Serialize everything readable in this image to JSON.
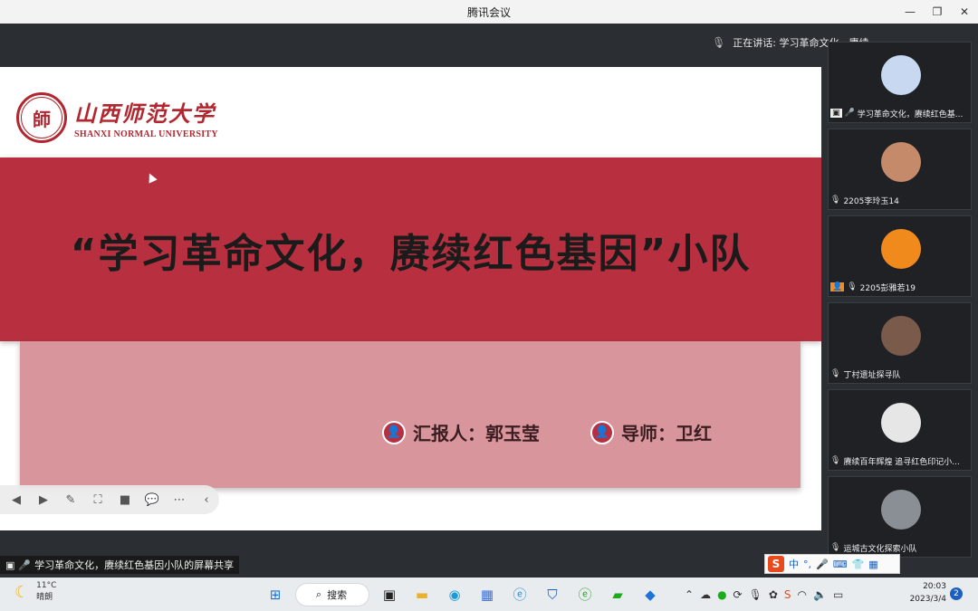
{
  "window": {
    "title": "腾讯会议"
  },
  "speaking": {
    "text": "正在讲话: 学习革命文化，赓续..."
  },
  "slide": {
    "university_cn": "山西师范大学",
    "university_en": "SHANXI NORMAL UNIVERSITY",
    "title": "“学习革命文化，赓续红色基因”小队",
    "reporter": "汇报人：郭玉莹",
    "advisor": "导师：卫红"
  },
  "participants": [
    {
      "name": "学习革命文化，赓续红色基...",
      "sharing": true,
      "avatar_color": "#c7d8f0"
    },
    {
      "name": "2205李玲玉14",
      "sharing": false,
      "avatar_color": "#c48a6a"
    },
    {
      "name": "2205彭雅若19",
      "sharing": false,
      "avatar_color": "#f08a1c",
      "host": true
    },
    {
      "name": "丁村遗址探寻队",
      "sharing": false,
      "avatar_color": "#7a5a4a"
    },
    {
      "name": "赓续百年辉煌 追寻红色印记小...",
      "sharing": false,
      "avatar_color": "#e6e6e6"
    },
    {
      "name": "运城古文化探索小队",
      "sharing": false,
      "avatar_color": "#8a8f96"
    }
  ],
  "share_caption": "学习革命文化，赓续红色基因小队的屏幕共享",
  "ime": {
    "mode": "中"
  },
  "taskbar": {
    "temperature": "11°C",
    "weather": "晴朗",
    "search": "搜索",
    "time": "20:03",
    "date": "2023/3/4",
    "notifications": "2"
  }
}
